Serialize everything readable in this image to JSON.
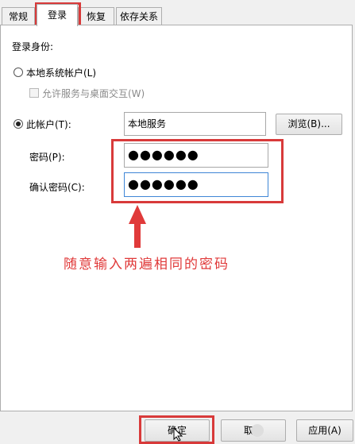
{
  "tabs": [
    {
      "label": "常规",
      "active": false
    },
    {
      "label": "登录",
      "active": true
    },
    {
      "label": "恢复",
      "active": false
    },
    {
      "label": "依存关系",
      "active": false
    }
  ],
  "logon": {
    "section_label": "登录身份:",
    "local_system": {
      "label": "本地系统帐户(L)",
      "selected": false
    },
    "allow_desktop": {
      "label": "允许服务与桌面交互(W)",
      "checked": false,
      "enabled": false
    },
    "this_account": {
      "label": "此帐户(T):",
      "selected": true,
      "value": "本地服务"
    },
    "browse_label": "浏览(B)...",
    "password": {
      "label": "密码(P):",
      "value": "●●●●●●"
    },
    "confirm": {
      "label": "确认密码(C):",
      "value": "●●●●●●"
    }
  },
  "annotation": {
    "text": "随意输入两遍相同的密码",
    "color": "#e03a3a"
  },
  "footer": {
    "ok_label": "确定",
    "cancel_label": "取",
    "apply_label": "应用(A)"
  },
  "colors": {
    "highlight": "#d83a3a"
  }
}
